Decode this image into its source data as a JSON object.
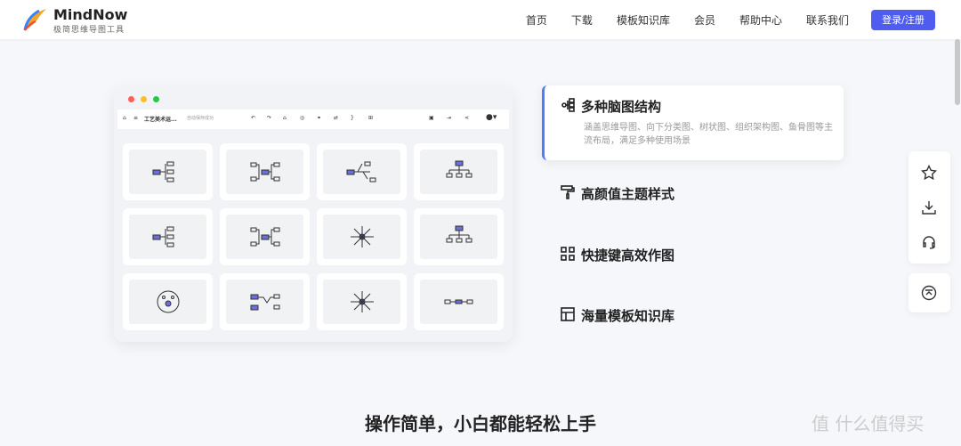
{
  "nav": {
    "brand": "MindNow",
    "tagline": "极简思维导图工具",
    "items": [
      "首页",
      "下载",
      "模板知识库",
      "会员",
      "帮助中心",
      "联系我们"
    ],
    "login": "登录/注册"
  },
  "app": {
    "file_name": "工艺美术运...",
    "save_status": "自动保存成功"
  },
  "features": [
    {
      "title": "多种脑图结构",
      "desc": "涵盖思维导图、向下分类图、树状图、组织架构图、鱼骨图等主流布局，满足多种使用场景",
      "icon": "structure-icon"
    },
    {
      "title": "高颜值主题样式",
      "icon": "paint-roller-icon"
    },
    {
      "title": "快捷键高效作图",
      "icon": "grid-icon"
    },
    {
      "title": "海量模板知识库",
      "icon": "layout-icon"
    }
  ],
  "section_title": "操作简单，小白都能轻松上手",
  "watermark": "值 什么值得买",
  "colors": {
    "accent": "#4f5cf0",
    "node": "#6b6fd8"
  }
}
